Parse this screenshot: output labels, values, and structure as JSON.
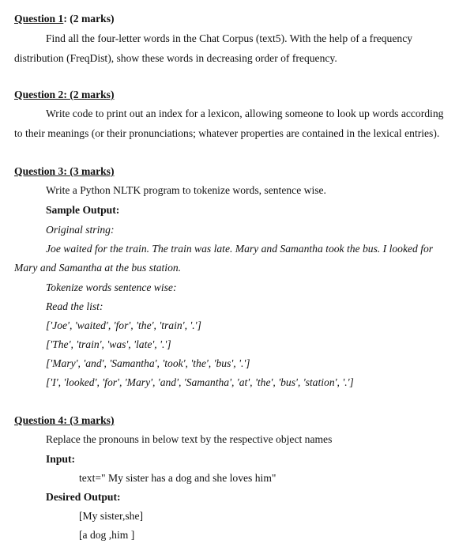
{
  "q1": {
    "label": "Question 1",
    "sep": ":",
    "marks": " (2 marks)",
    "line1": "Find all the four-letter words in the Chat Corpus (text5). With the help of a frequency",
    "line2": "distribution (FreqDist), show these words in decreasing order of frequency."
  },
  "q2": {
    "label": "Question 2: (2 marks)",
    "line1": "Write code to print out an index for a lexicon, allowing someone to look up words according",
    "line2": "to their meanings (or their pronunciations; whatever properties are contained in the lexical entries)."
  },
  "q3": {
    "label": "Question 3: (3 marks)",
    "task": "Write a Python NLTK program to tokenize words, sentence wise.",
    "sample_output_label": "Sample Output:",
    "original_label": "Original string:",
    "original_line1": "Joe waited for the train. The train was late. Mary and Samantha took the bus. I looked for",
    "original_line2": "Mary and Samantha at the bus station.",
    "tokenize_label": "Tokenize words sentence wise:",
    "read_list_label": "Read the list:",
    "list_items": [
      "['Joe', 'waited', 'for', 'the', 'train', '.']",
      "['The', 'train', 'was', 'late', '.']",
      "['Mary', 'and', 'Samantha', 'took', 'the', 'bus', '.']",
      "['I', 'looked', 'for', 'Mary', 'and', 'Samantha', 'at', 'the', 'bus', 'station', '.']"
    ]
  },
  "q4": {
    "label": "Question 4: (3 marks)",
    "task": "Replace the pronouns in below text by the respective object names",
    "input_label": "Input:",
    "input_text": "text=\" My sister has a dog and she loves him\"",
    "desired_output_label": "Desired Output:",
    "outputs": [
      "[My sister,she]",
      "[a dog ,him ]"
    ]
  }
}
